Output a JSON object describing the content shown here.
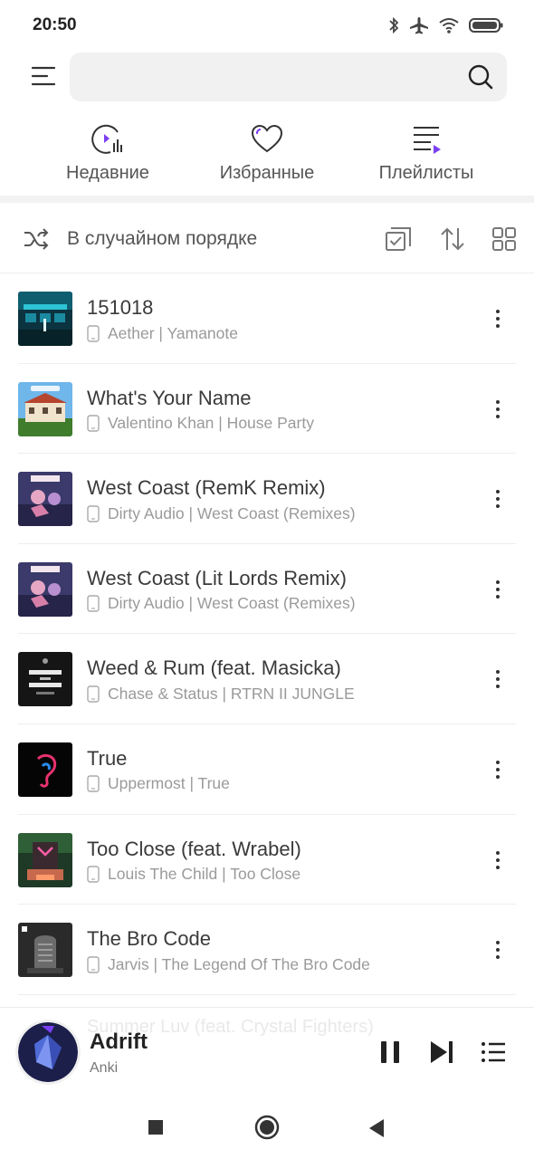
{
  "status_bar": {
    "time": "20:50",
    "icons": [
      "bluetooth-icon",
      "airplane-icon",
      "wifi-icon",
      "battery-icon"
    ]
  },
  "search": {
    "value": "",
    "placeholder": ""
  },
  "categories": [
    {
      "label": "Недавние",
      "icon": "recent-icon"
    },
    {
      "label": "Избранные",
      "icon": "heart-icon"
    },
    {
      "label": "Плейлисты",
      "icon": "playlist-icon"
    }
  ],
  "toolbar": {
    "shuffle_label": "В случайном порядке"
  },
  "songs": [
    {
      "title": "151018",
      "subtitle": "Aether | Yamanote"
    },
    {
      "title": "What's Your Name",
      "subtitle": "Valentino Khan | House Party"
    },
    {
      "title": "West Coast (RemK Remix)",
      "subtitle": "Dirty Audio | West Coast (Remixes)"
    },
    {
      "title": "West Coast (Lit Lords Remix)",
      "subtitle": "Dirty Audio | West Coast (Remixes)"
    },
    {
      "title": "Weed & Rum (feat. Masicka)",
      "subtitle": "Chase & Status | RTRN II JUNGLE"
    },
    {
      "title": "True",
      "subtitle": "Uppermost | True"
    },
    {
      "title": "Too Close (feat. Wrabel)",
      "subtitle": "Louis The Child | Too Close"
    },
    {
      "title": "The Bro Code",
      "subtitle": "Jarvis | The Legend Of The Bro Code"
    }
  ],
  "now_playing": {
    "title": "Adrift",
    "artist": "Anki",
    "behind_text": "Summer Luv (feat. Crystal Fighters)"
  },
  "colors": {
    "accent": "#7b3ff2",
    "text_primary": "#3a3a3a",
    "text_secondary": "#9a9a9a"
  }
}
